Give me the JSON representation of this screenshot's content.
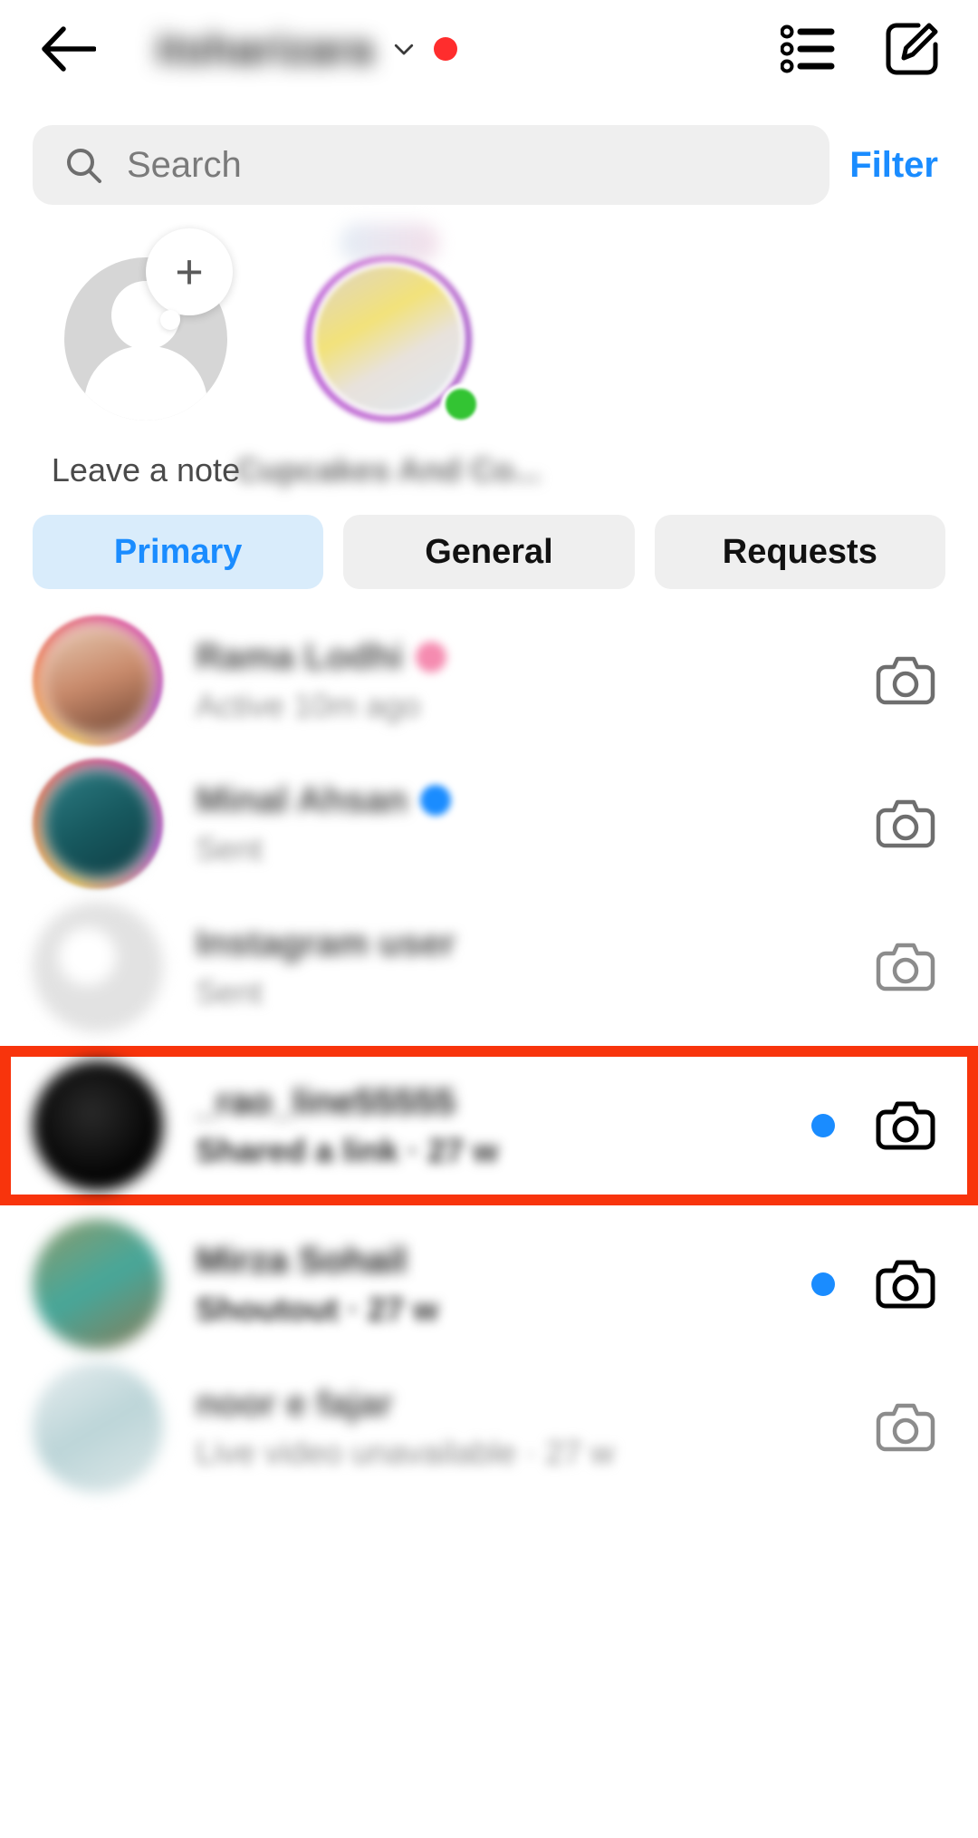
{
  "header": {
    "back_icon": "back-arrow-icon",
    "username": "itsharizara",
    "chevron_icon": "chevron-down-icon",
    "unread_badge": "",
    "list_icon": "message-requests-list-icon",
    "compose_icon": "new-message-compose-icon"
  },
  "search": {
    "icon": "search-icon",
    "placeholder": "Search",
    "value": "",
    "filter_label": "Filter"
  },
  "notes": [
    {
      "label": "Leave a note",
      "type": "self",
      "plus_icon": "plus-icon",
      "online": false
    },
    {
      "label": "Cupcakes And Co...",
      "type": "friend",
      "plus_icon": "",
      "online": true
    }
  ],
  "tabs": [
    {
      "label": "Primary",
      "active": true
    },
    {
      "label": "General",
      "active": false
    },
    {
      "label": "Requests",
      "active": false
    }
  ],
  "conversations": [
    {
      "name": "Rama Lodhi",
      "preview": "Active 10m ago",
      "badge": "heart",
      "unread": false,
      "highlighted": false,
      "camera_icon": "camera-icon",
      "avatar_ring": true,
      "avatar_color": "linear-gradient(160deg,#e6cbb4,#c98a6b,#6b4230)"
    },
    {
      "name": "Minal Ahsan",
      "preview": "Sent",
      "badge": "verified",
      "unread": false,
      "highlighted": false,
      "camera_icon": "camera-icon",
      "avatar_ring": true,
      "avatar_color": "linear-gradient(150deg,#2f7f86,#17595f,#0e3b42)"
    },
    {
      "name": "Instagram user",
      "preview": "Sent",
      "badge": "",
      "unread": false,
      "highlighted": false,
      "camera_icon": "camera-icon",
      "avatar_ring": false,
      "avatar_color": "radial-gradient(circle at 42% 42%,#ffffff 26%,#e2e2e2 28%,#e2e2e2 100%)"
    },
    {
      "name": "_rao_line55555",
      "preview": "Shared a link  ·  27 w",
      "badge": "",
      "unread": true,
      "highlighted": true,
      "camera_icon": "camera-icon",
      "avatar_ring": false,
      "avatar_color": "radial-gradient(circle at 45% 40%,#2a2a2a,#000000 70%)"
    },
    {
      "name": "Mirza Sohail",
      "preview": "Shoutout  ·  27 w",
      "badge": "",
      "unread": true,
      "highlighted": false,
      "camera_icon": "camera-icon",
      "avatar_ring": false,
      "avatar_color": "linear-gradient(150deg,#8e9a6a,#46a79a,#8a7a55)"
    },
    {
      "name": "noor e fajar",
      "preview": "Live video unavailable  ·  27 w",
      "badge": "",
      "unread": false,
      "highlighted": false,
      "camera_icon": "camera-icon",
      "avatar_ring": false,
      "avatar_color": "linear-gradient(150deg,#e8eef0,#bcd5d8,#dfe9ea)"
    }
  ],
  "colors": {
    "accent_blue": "#1a8cff",
    "highlight_red": "#f8340c",
    "tab_active_bg": "#d9ecfb",
    "field_bg": "#efefef",
    "online_green": "#33c433"
  }
}
